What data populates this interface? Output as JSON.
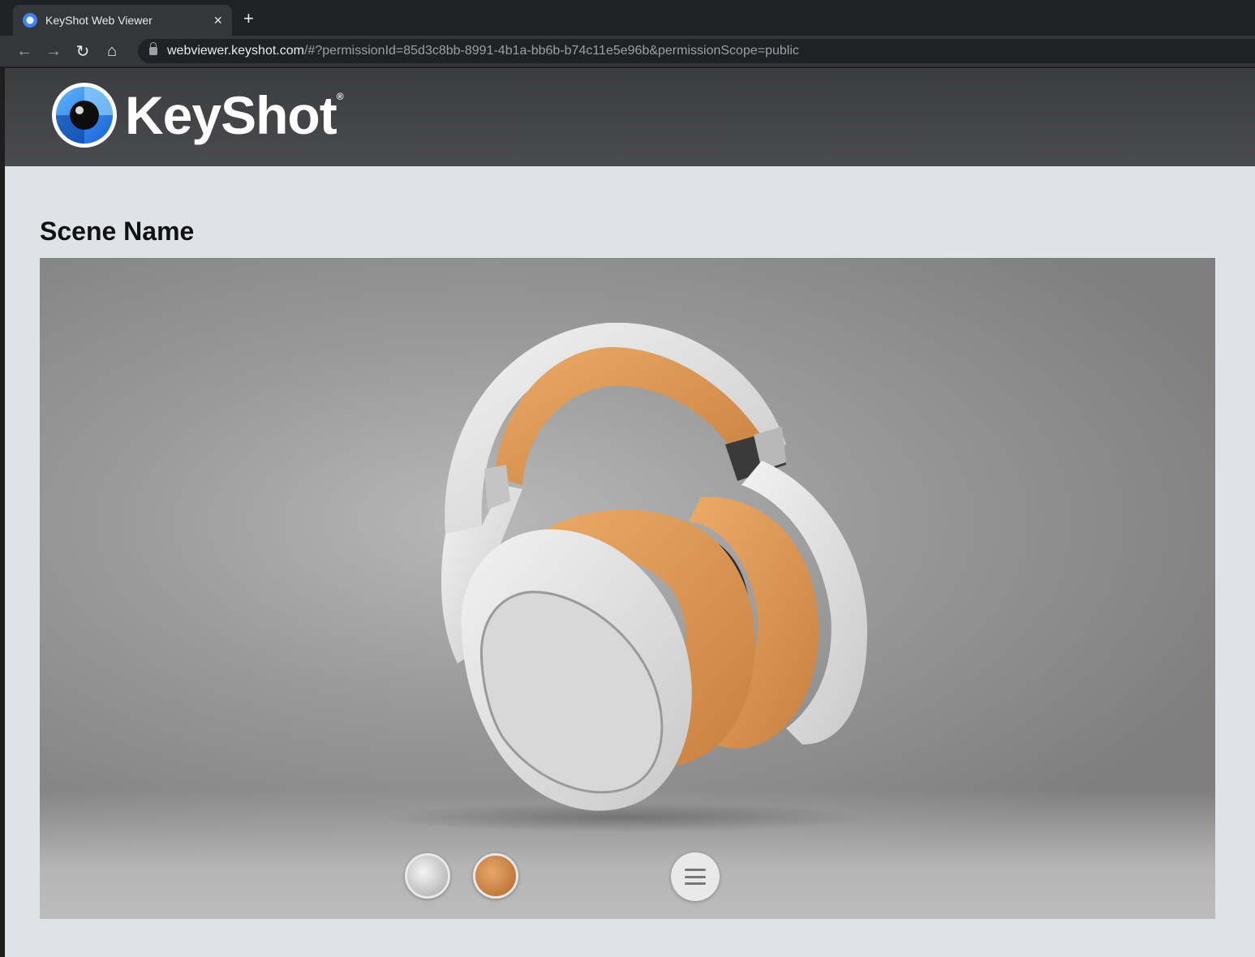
{
  "browser": {
    "tab_title": "KeyShot Web Viewer",
    "tab_close": "×",
    "new_tab": "+",
    "back": "←",
    "forward": "→",
    "reload": "↻",
    "home": "⌂",
    "url_host": "webviewer.keyshot.com",
    "url_rest": "/#?permissionId=85d3c8bb-8991-4b1a-bb6b-b74c11e5e96b&permissionScope=public"
  },
  "site": {
    "logo_text": "KeyShot",
    "logo_reg": "®"
  },
  "scene": {
    "title": "Scene Name"
  },
  "viewer": {
    "variants": [
      {
        "name": "white",
        "color": "#c8c8c8"
      },
      {
        "name": "orange",
        "color": "#d08a4a"
      }
    ],
    "accent_orange": "#e09a55",
    "shell_white": "#e6e6e6"
  }
}
